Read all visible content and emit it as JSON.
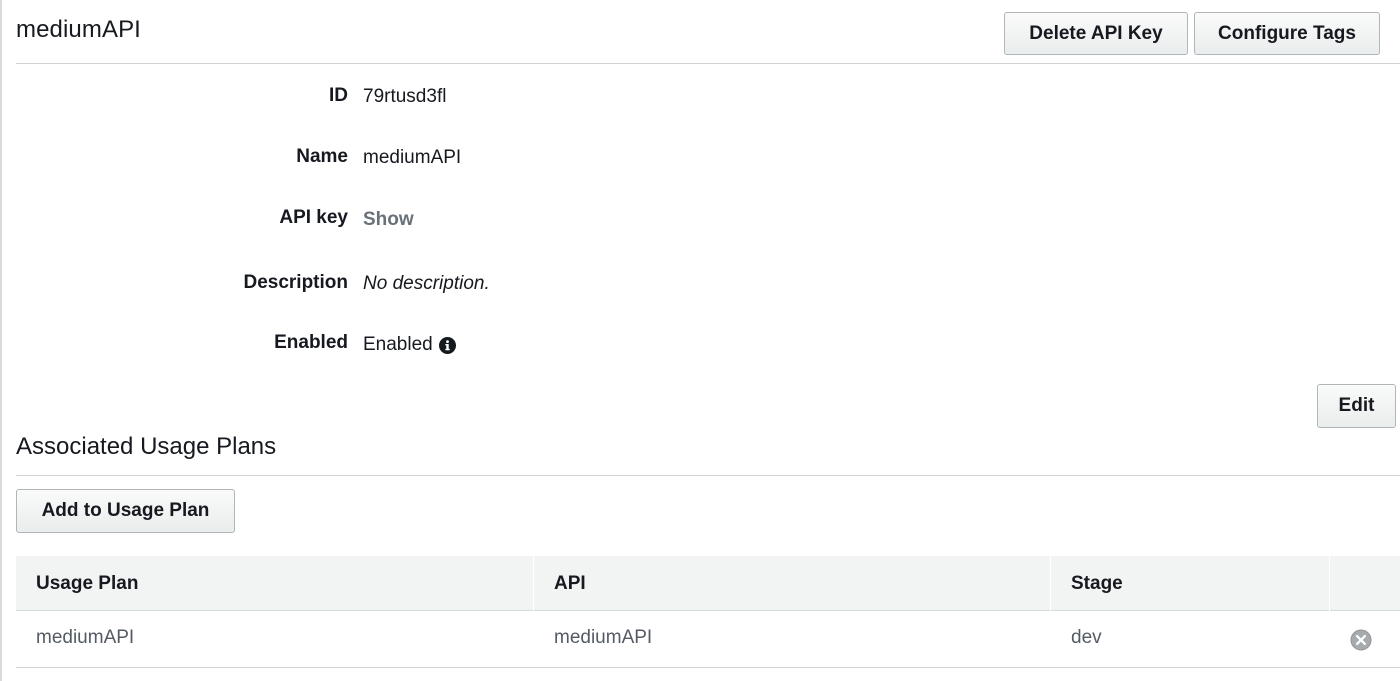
{
  "header": {
    "title": "mediumAPI",
    "delete_label": "Delete API Key",
    "configure_tags_label": "Configure Tags"
  },
  "details": {
    "id": {
      "label": "ID",
      "value": "79rtusd3fl"
    },
    "name": {
      "label": "Name",
      "value": "mediumAPI"
    },
    "api_key": {
      "label": "API key",
      "value": "Show"
    },
    "description": {
      "label": "Description",
      "value": "No description."
    },
    "enabled": {
      "label": "Enabled",
      "value": "Enabled",
      "icon": "info-icon"
    }
  },
  "edit_label": "Edit",
  "usage_plans": {
    "title": "Associated Usage Plans",
    "add_label": "Add to Usage Plan",
    "columns": [
      "Usage Plan",
      "API",
      "Stage"
    ],
    "rows": [
      {
        "usage_plan": "mediumAPI",
        "api": "mediumAPI",
        "stage": "dev",
        "action_icon": "remove-icon"
      }
    ]
  },
  "colors": {
    "button_border": "#b0b6b8",
    "table_header_bg": "#f2f3f3",
    "link_muted": "#687078",
    "cell_text": "#545b64"
  }
}
